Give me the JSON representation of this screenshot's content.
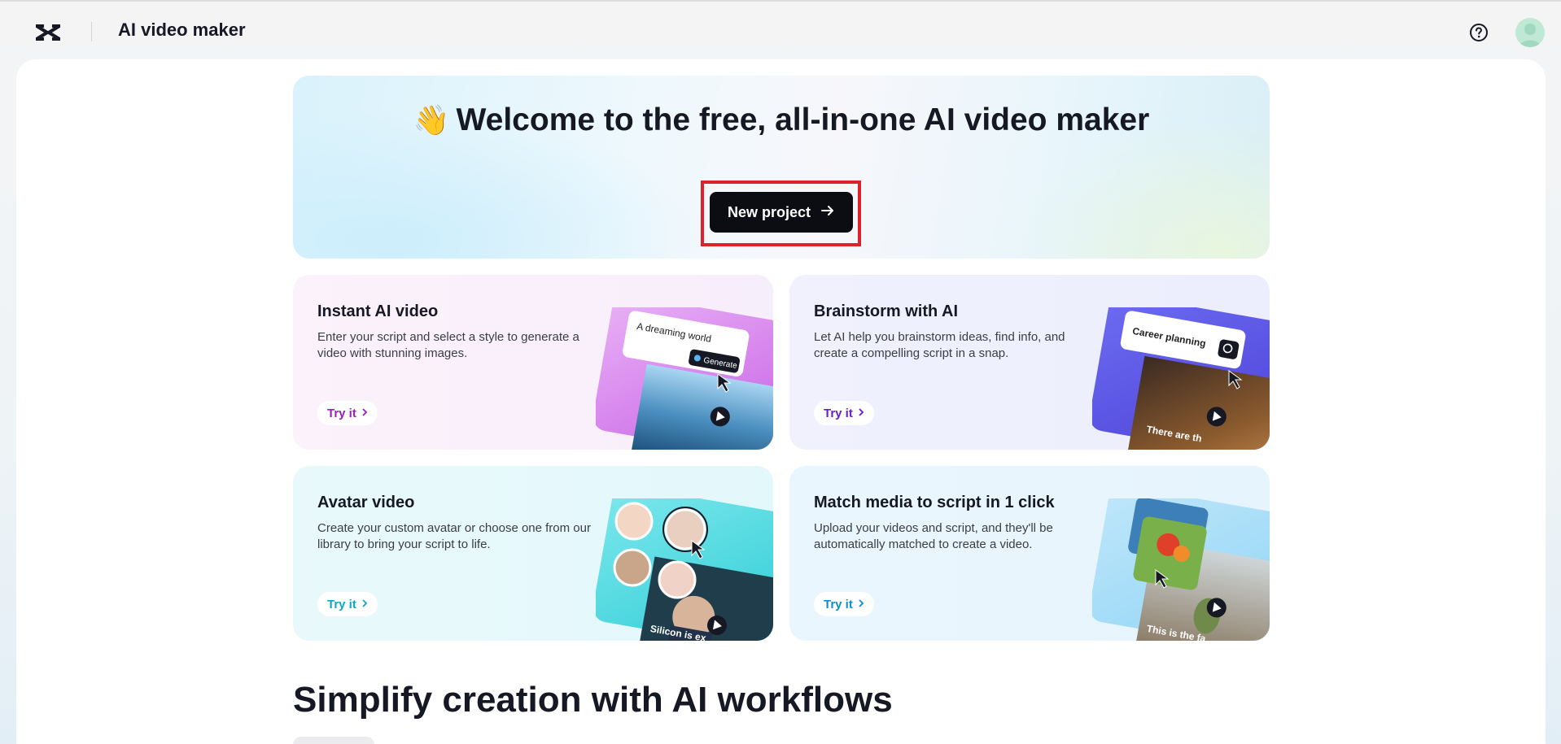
{
  "header": {
    "app_title": "AI video maker",
    "logo_icon": "capcut-logo-icon",
    "help_icon": "help-circle-icon",
    "avatar_icon": "user-avatar-icon"
  },
  "hero": {
    "emoji": "👋",
    "title": "Welcome to the free, all-in-one AI video maker",
    "cta_label": "New project",
    "cta_icon": "arrow-right-icon"
  },
  "cards": [
    {
      "title": "Instant AI video",
      "description": "Enter your script and select a style to generate a video with stunning images.",
      "cta": "Try it",
      "accent": "#9b1bc4",
      "art": {
        "input_text": "A dreaming world",
        "button_text": "Generate"
      }
    },
    {
      "title": "Brainstorm with AI",
      "description": "Let AI help you brainstorm ideas, find info, and create a compelling script in a snap.",
      "cta": "Try it",
      "accent": "#6a1bd1",
      "art": {
        "input_text": "Career planning",
        "caption": "There are th"
      }
    },
    {
      "title": "Avatar video",
      "description": "Create your custom avatar or choose one from our library to bring your script to life.",
      "cta": "Try it",
      "accent": "#0ea5c6",
      "art": {
        "caption": "Silicon is ex"
      }
    },
    {
      "title": "Match media to script in 1 click",
      "description": "Upload your videos and script, and they'll be automatically matched to create a video.",
      "cta": "Try it",
      "accent": "#0a8fd6",
      "art": {
        "caption": "This is the fa"
      }
    }
  ],
  "section": {
    "title": "Simplify creation with AI workflows"
  },
  "colors": {
    "primary_button": "#0b0d12",
    "highlight_box": "#e0202a",
    "text": "#161823"
  }
}
